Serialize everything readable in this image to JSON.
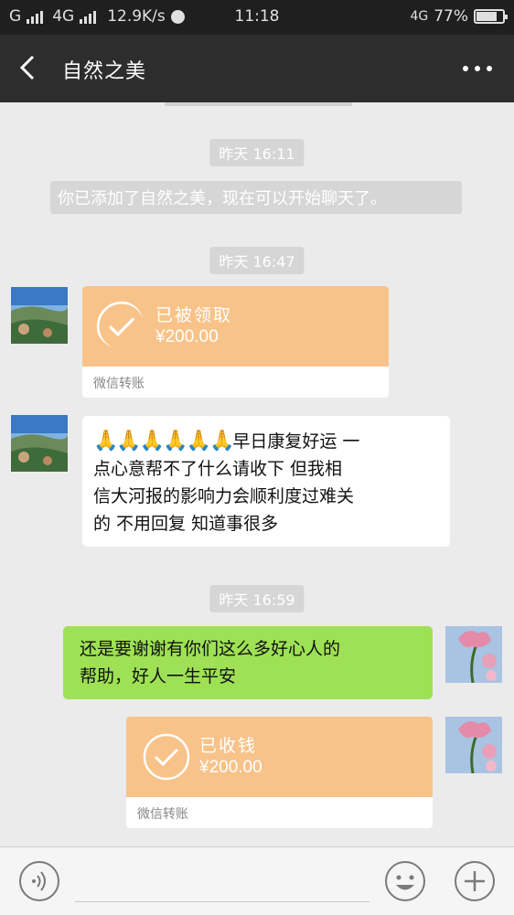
{
  "status_bar": {
    "carrier1": "G",
    "carrier2": "4G",
    "speed": "12.9K/s",
    "time": "11:18",
    "network": "4G",
    "battery_percent": "77%",
    "battery_level": 0.77
  },
  "header": {
    "title": "自然之美",
    "back_icon": "chevron-left-icon",
    "more_icon": "more-dots-icon"
  },
  "messages": {
    "ts1": "昨天 16:11",
    "system_msg": "你已添加了自然之美，现在可以开始聊天了。",
    "ts2": "昨天 16:47",
    "transfer1": {
      "status": "已被领取",
      "amount": "¥200.00",
      "footer": "微信转账"
    },
    "text1": {
      "emoji": "🙏🙏🙏🙏🙏🙏",
      "line1": "早日康复好运  一",
      "line2": "点心意帮不了什么请收下  但我相",
      "line3": "信大河报的影响力会顺利度过难关",
      "line4": "的  不用回复  知道事很多"
    },
    "ts3": "昨天 16:59",
    "text2": {
      "line1": "还是要谢谢有你们这么多好心人的",
      "line2": "帮助，好人一生平安"
    },
    "transfer2": {
      "status": "已收钱",
      "amount": "¥200.00",
      "footer": "微信转账"
    }
  },
  "colors": {
    "transfer_orange": "#f8c389",
    "bubble_green": "#9ee155",
    "header_bg": "#2d2d2d"
  },
  "input_bar": {
    "voice_icon": "voice-icon",
    "emoji_icon": "smiley-icon",
    "plus_icon": "plus-icon"
  }
}
